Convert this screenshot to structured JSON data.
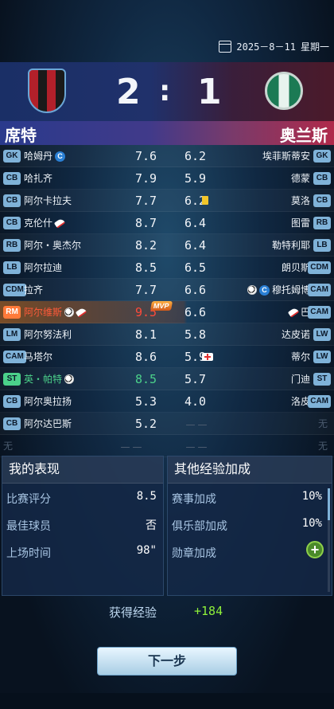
{
  "header": {
    "date": "2025－8－11",
    "weekday": "星期一"
  },
  "match": {
    "home_team": "席特",
    "away_team": "奥兰斯",
    "home_score": "2",
    "separator": ":",
    "away_score": "1",
    "home_colors": [
      "#b2202a",
      "#1a1a1a"
    ],
    "away_colors": [
      "#1b7a54",
      "#e8f3ee"
    ]
  },
  "rows": [
    {
      "l_pos": "GK",
      "l_name": "哈姆丹",
      "l_assist": "C",
      "l_rate": "7.6",
      "r_rate": "6.2",
      "r_name": "埃菲斯蒂安",
      "r_pos": "GK"
    },
    {
      "l_pos": "CB",
      "l_name": "哈扎齐",
      "l_rate": "7.9",
      "r_rate": "5.9",
      "r_name": "德蒙",
      "r_pos": "CB"
    },
    {
      "l_pos": "CB",
      "l_name": "阿尔卡拉夫",
      "l_rate": "7.7",
      "r_rate": "6.2",
      "r_name": "莫洛",
      "r_pos": "CB",
      "r_card": "yellow-card"
    },
    {
      "l_pos": "CB",
      "l_name": "克伦什",
      "l_icon": "boot-icon",
      "l_rate": "8.7",
      "r_rate": "6.4",
      "r_name": "图雷",
      "r_pos": "RB"
    },
    {
      "l_pos": "RB",
      "l_name": "阿尔・奥杰尔",
      "l_rate": "8.2",
      "r_rate": "6.4",
      "r_name": "勒特利耶",
      "r_pos": "LB"
    },
    {
      "l_pos": "LB",
      "l_name": "阿尔拉迪",
      "l_rate": "8.5",
      "r_rate": "6.5",
      "r_name": "朗贝斯",
      "r_pos": "CDM"
    },
    {
      "l_pos": "CDM",
      "l_name": "拉齐",
      "l_rate": "7.7",
      "r_rate": "6.6",
      "r_name": "穆托姆博",
      "r_pos": "CAM",
      "r_ball": true,
      "r_assist": "C"
    },
    {
      "l_pos": "RM",
      "l_name": "阿尔维斯",
      "l_rate": "9.5",
      "mvp": "MVP",
      "r_rate": "6.6",
      "r_name": "巴",
      "r_pos": "CAM"
    },
    {
      "l_pos": "LM",
      "l_name": "阿尔努法利",
      "l_rate": "8.1",
      "r_rate": "5.8",
      "r_name": "达皮诺",
      "r_pos": "LW"
    },
    {
      "l_pos": "CAM",
      "l_name": "马塔尔",
      "l_rate": "8.6",
      "r_rate": "5.9",
      "r_name": "蒂尔",
      "r_pos": "LW",
      "r_injury": true
    },
    {
      "l_pos": "ST",
      "l_name": "英・帕特",
      "l_rate": "8.5",
      "r_rate": "5.7",
      "r_name": "门迪",
      "r_pos": "ST"
    },
    {
      "l_pos": "CB",
      "l_name": "阿尔奥拉扬",
      "l_rate": "5.3",
      "r_rate": "4.0",
      "r_name": "洛皮",
      "r_pos": "CAM"
    },
    {
      "l_pos": "CB",
      "l_name": "阿尔达巴斯",
      "l_rate": "5.2",
      "r_rate": "－－",
      "r_name": "无",
      "r_pos": ""
    },
    {
      "l_pos": "",
      "l_name": "无",
      "l_rate": "－－",
      "r_rate": "－－",
      "r_name": "无",
      "r_pos": ""
    }
  ],
  "my_perf": {
    "title": "我的表现",
    "rating_label": "比赛评分",
    "rating": "8.5",
    "best_label": "最佳球员",
    "best": "否",
    "time_label": "上场时间",
    "time": "98\""
  },
  "bonus": {
    "title": "其他经验加成",
    "event_label": "赛事加成",
    "event": "10%",
    "club_label": "俱乐部加成",
    "club": "10%",
    "badge_label": "勋章加成"
  },
  "exp": {
    "label": "获得经验",
    "value": "+184"
  },
  "next_button": "下一步"
}
